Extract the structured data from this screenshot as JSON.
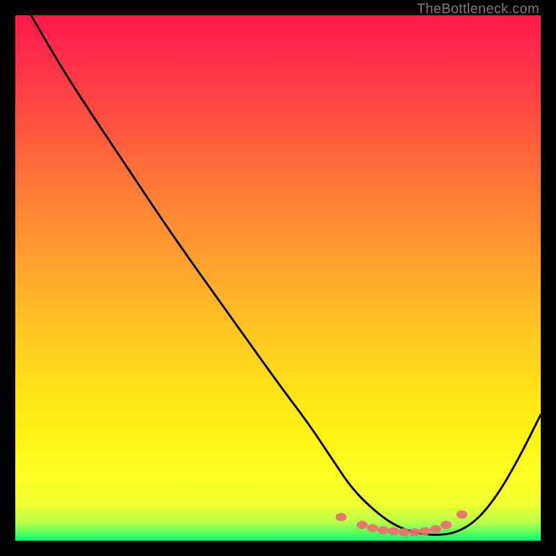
{
  "watermark": "TheBottleneck.com",
  "chart_data": {
    "type": "line",
    "title": "",
    "xlabel": "",
    "ylabel": "",
    "xlim": [
      0,
      100
    ],
    "ylim": [
      0,
      100
    ],
    "grid": false,
    "series": [
      {
        "name": "bottleneck-curve",
        "color": "#000000",
        "x": [
          3,
          10,
          20,
          30,
          40,
          50,
          56,
          60,
          64,
          68,
          72,
          76,
          80,
          84,
          88,
          92,
          96,
          100
        ],
        "values": [
          100,
          88,
          73,
          58,
          44,
          30,
          22,
          16,
          10,
          6,
          3,
          1.5,
          1,
          1.5,
          4,
          9,
          16,
          24
        ]
      }
    ],
    "markers": {
      "name": "highlight-dots",
      "color": "#e87070",
      "x": [
        62,
        66,
        68,
        70,
        72,
        74,
        76,
        78,
        80,
        82,
        85
      ],
      "values": [
        4.5,
        3.0,
        2.4,
        2.0,
        1.8,
        1.6,
        1.6,
        1.8,
        2.2,
        3.0,
        5.0
      ]
    },
    "background_gradient": {
      "top": "#ff1a4a",
      "mid": "#fff313",
      "bottom": "#00ff7a"
    }
  }
}
